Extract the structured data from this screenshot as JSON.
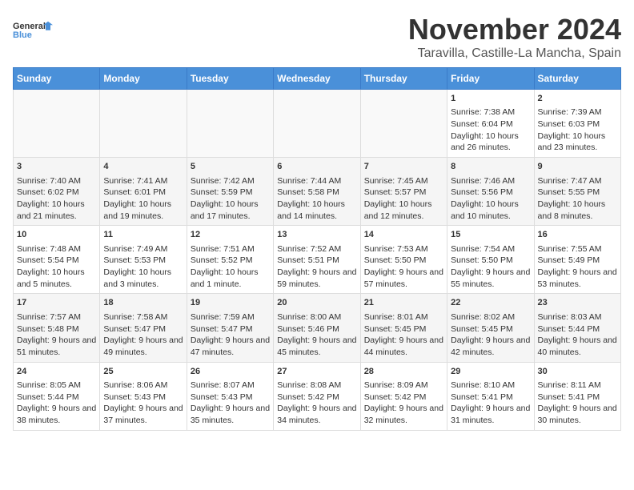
{
  "logo": {
    "general": "General",
    "blue": "Blue"
  },
  "title": "November 2024",
  "location": "Taravilla, Castille-La Mancha, Spain",
  "days_of_week": [
    "Sunday",
    "Monday",
    "Tuesday",
    "Wednesday",
    "Thursday",
    "Friday",
    "Saturday"
  ],
  "weeks": [
    [
      {
        "day": "",
        "info": ""
      },
      {
        "day": "",
        "info": ""
      },
      {
        "day": "",
        "info": ""
      },
      {
        "day": "",
        "info": ""
      },
      {
        "day": "",
        "info": ""
      },
      {
        "day": "1",
        "info": "Sunrise: 7:38 AM\nSunset: 6:04 PM\nDaylight: 10 hours and 26 minutes."
      },
      {
        "day": "2",
        "info": "Sunrise: 7:39 AM\nSunset: 6:03 PM\nDaylight: 10 hours and 23 minutes."
      }
    ],
    [
      {
        "day": "3",
        "info": "Sunrise: 7:40 AM\nSunset: 6:02 PM\nDaylight: 10 hours and 21 minutes."
      },
      {
        "day": "4",
        "info": "Sunrise: 7:41 AM\nSunset: 6:01 PM\nDaylight: 10 hours and 19 minutes."
      },
      {
        "day": "5",
        "info": "Sunrise: 7:42 AM\nSunset: 5:59 PM\nDaylight: 10 hours and 17 minutes."
      },
      {
        "day": "6",
        "info": "Sunrise: 7:44 AM\nSunset: 5:58 PM\nDaylight: 10 hours and 14 minutes."
      },
      {
        "day": "7",
        "info": "Sunrise: 7:45 AM\nSunset: 5:57 PM\nDaylight: 10 hours and 12 minutes."
      },
      {
        "day": "8",
        "info": "Sunrise: 7:46 AM\nSunset: 5:56 PM\nDaylight: 10 hours and 10 minutes."
      },
      {
        "day": "9",
        "info": "Sunrise: 7:47 AM\nSunset: 5:55 PM\nDaylight: 10 hours and 8 minutes."
      }
    ],
    [
      {
        "day": "10",
        "info": "Sunrise: 7:48 AM\nSunset: 5:54 PM\nDaylight: 10 hours and 5 minutes."
      },
      {
        "day": "11",
        "info": "Sunrise: 7:49 AM\nSunset: 5:53 PM\nDaylight: 10 hours and 3 minutes."
      },
      {
        "day": "12",
        "info": "Sunrise: 7:51 AM\nSunset: 5:52 PM\nDaylight: 10 hours and 1 minute."
      },
      {
        "day": "13",
        "info": "Sunrise: 7:52 AM\nSunset: 5:51 PM\nDaylight: 9 hours and 59 minutes."
      },
      {
        "day": "14",
        "info": "Sunrise: 7:53 AM\nSunset: 5:50 PM\nDaylight: 9 hours and 57 minutes."
      },
      {
        "day": "15",
        "info": "Sunrise: 7:54 AM\nSunset: 5:50 PM\nDaylight: 9 hours and 55 minutes."
      },
      {
        "day": "16",
        "info": "Sunrise: 7:55 AM\nSunset: 5:49 PM\nDaylight: 9 hours and 53 minutes."
      }
    ],
    [
      {
        "day": "17",
        "info": "Sunrise: 7:57 AM\nSunset: 5:48 PM\nDaylight: 9 hours and 51 minutes."
      },
      {
        "day": "18",
        "info": "Sunrise: 7:58 AM\nSunset: 5:47 PM\nDaylight: 9 hours and 49 minutes."
      },
      {
        "day": "19",
        "info": "Sunrise: 7:59 AM\nSunset: 5:47 PM\nDaylight: 9 hours and 47 minutes."
      },
      {
        "day": "20",
        "info": "Sunrise: 8:00 AM\nSunset: 5:46 PM\nDaylight: 9 hours and 45 minutes."
      },
      {
        "day": "21",
        "info": "Sunrise: 8:01 AM\nSunset: 5:45 PM\nDaylight: 9 hours and 44 minutes."
      },
      {
        "day": "22",
        "info": "Sunrise: 8:02 AM\nSunset: 5:45 PM\nDaylight: 9 hours and 42 minutes."
      },
      {
        "day": "23",
        "info": "Sunrise: 8:03 AM\nSunset: 5:44 PM\nDaylight: 9 hours and 40 minutes."
      }
    ],
    [
      {
        "day": "24",
        "info": "Sunrise: 8:05 AM\nSunset: 5:44 PM\nDaylight: 9 hours and 38 minutes."
      },
      {
        "day": "25",
        "info": "Sunrise: 8:06 AM\nSunset: 5:43 PM\nDaylight: 9 hours and 37 minutes."
      },
      {
        "day": "26",
        "info": "Sunrise: 8:07 AM\nSunset: 5:43 PM\nDaylight: 9 hours and 35 minutes."
      },
      {
        "day": "27",
        "info": "Sunrise: 8:08 AM\nSunset: 5:42 PM\nDaylight: 9 hours and 34 minutes."
      },
      {
        "day": "28",
        "info": "Sunrise: 8:09 AM\nSunset: 5:42 PM\nDaylight: 9 hours and 32 minutes."
      },
      {
        "day": "29",
        "info": "Sunrise: 8:10 AM\nSunset: 5:41 PM\nDaylight: 9 hours and 31 minutes."
      },
      {
        "day": "30",
        "info": "Sunrise: 8:11 AM\nSunset: 5:41 PM\nDaylight: 9 hours and 30 minutes."
      }
    ]
  ]
}
